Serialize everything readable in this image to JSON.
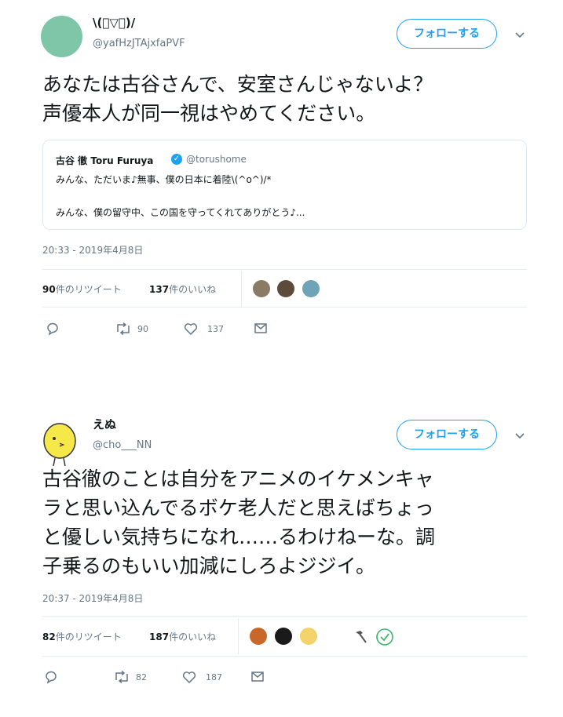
{
  "tweets": [
    {
      "display_name": "\\(ﾟ▽ﾟ)/",
      "handle": "@yafHzJTAjxfaPVF",
      "follow_label": "フォローする",
      "text_lines": [
        "あなたは古谷さんで、安室さんじゃないよ？",
        "声優本人が同一視はやめてください。"
      ],
      "quote": {
        "name": "古谷 徹 Toru Furuya",
        "verified": "✓",
        "handle": "@torushome",
        "line1": "みんな、ただいま♪無事、僕の日本に着陸\\(^o^)/*",
        "line2": "みんな、僕の留守中、この国を守ってくれてありがとう♪..."
      },
      "timestamp": "20:33 - 2019年4月8日",
      "retweets_count": "90",
      "retweets_label": "件のリツイート",
      "likes_count": "137",
      "likes_label": "件のいいね",
      "actions": {
        "retweet": "90",
        "like": "137"
      }
    },
    {
      "display_name": "えぬ",
      "handle": "@cho___NN",
      "follow_label": "フォローする",
      "text_lines": [
        "古谷徹のことは自分をアニメのイケメンキャ",
        "ラと思い込んでるボケ老人だと思えばちょっ",
        "と優しい気持ちになれ……るわけねーな。調",
        "子乗るのもいい加減にしろよジジイ。"
      ],
      "timestamp": "20:37 - 2019年4月8日",
      "retweets_count": "82",
      "retweets_label": "件のリツイート",
      "likes_count": "187",
      "likes_label": "件のいいね",
      "actions": {
        "retweet": "82",
        "like": "187"
      }
    }
  ],
  "colors": {
    "accent": "#1da1f2",
    "muted": "#657786",
    "border": "#e6ecf0"
  }
}
